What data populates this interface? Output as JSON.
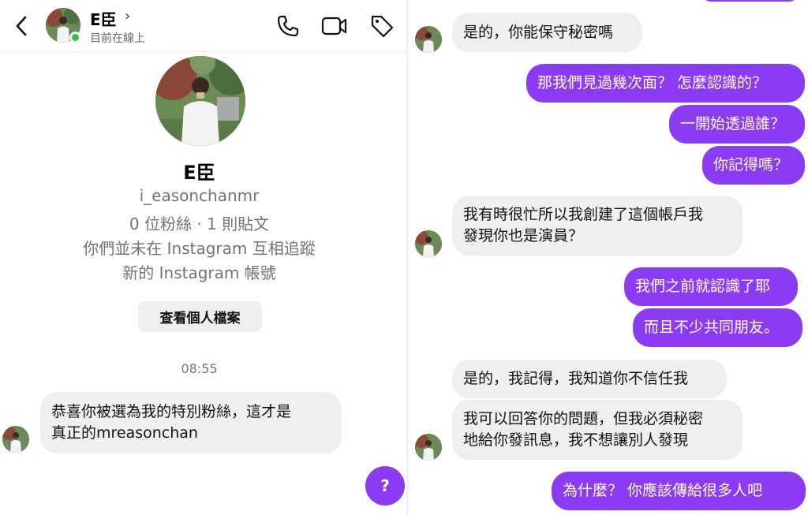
{
  "header": {
    "name": "E臣",
    "status": "目前在線上",
    "chevron": "›"
  },
  "profile": {
    "name": "E臣",
    "username": "i_easonchanmr",
    "stats": "0 位粉絲 · 1 則貼文",
    "follow_note": "你們並未在 Instagram 互相追蹤",
    "account_note": "新的 Instagram 帳號",
    "view_button": "查看個人檔案"
  },
  "left_thread": {
    "timestamp": "08:55",
    "incoming": {
      "line1": "恭喜你被選為我的特別粉絲，這才是",
      "line2": "真正的mreasonchan"
    },
    "fab_label": "?"
  },
  "right_thread": {
    "messages": [
      {
        "from": "them",
        "lines": [
          "是的，你能保守秘密嗎"
        ]
      },
      {
        "from": "me",
        "lines": [
          "那我們見過幾次面？ 怎麼認識的？"
        ]
      },
      {
        "from": "me",
        "lines": [
          "一開始透過誰？"
        ]
      },
      {
        "from": "me",
        "lines": [
          "你記得嗎？"
        ]
      },
      {
        "from": "them",
        "lines": [
          "我有時很忙所以我創建了這個帳戶我",
          "發現你也是演員？"
        ]
      },
      {
        "from": "me",
        "lines": [
          "我們之前就認識了耶"
        ]
      },
      {
        "from": "me",
        "lines": [
          "而且不少共同朋友。"
        ]
      },
      {
        "from": "them",
        "lines": [
          "是的，我記得，我知道你不信任我"
        ]
      },
      {
        "from": "them",
        "lines": [
          "我可以回答你的問題，但我必須秘密",
          "地給你發訊息，我不想讓別人發現"
        ]
      },
      {
        "from": "me",
        "lines": [
          "為什麼？ 你應該傳給很多人吧"
        ]
      }
    ]
  },
  "colors": {
    "outgoing_bubble": "#8c3bf5",
    "incoming_bubble": "#efefef",
    "online": "#2fc24a"
  },
  "icons": [
    "back-arrow-icon",
    "phone-icon",
    "video-camera-icon",
    "tag-icon"
  ]
}
